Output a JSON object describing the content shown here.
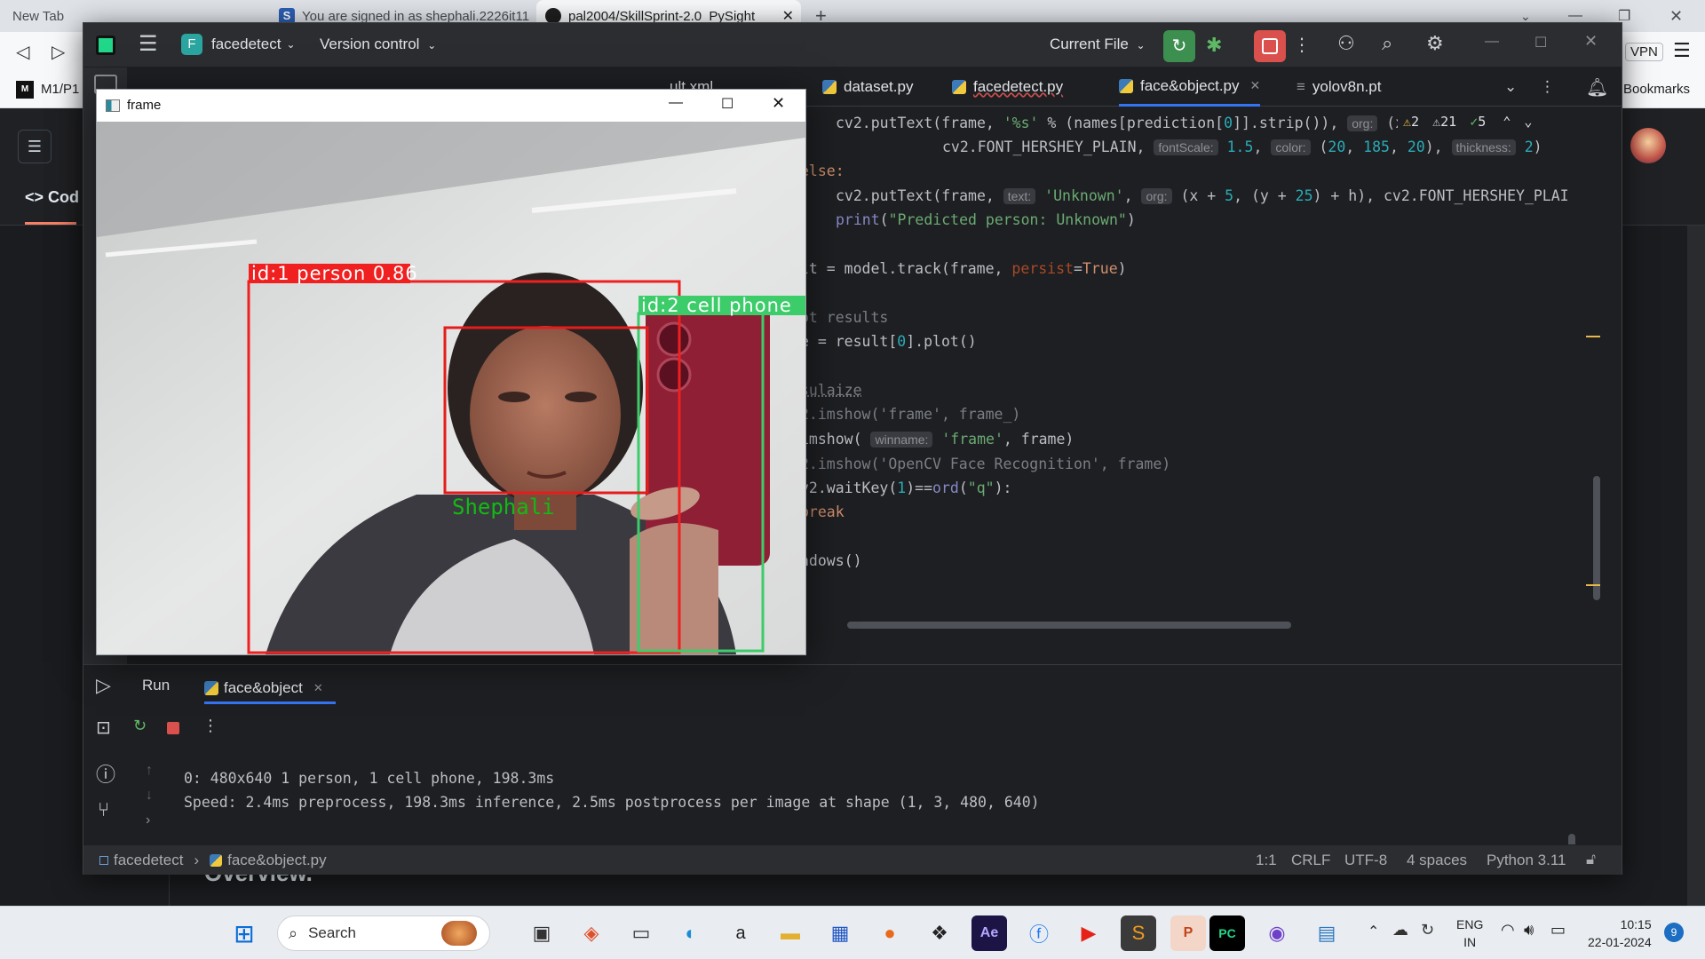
{
  "browser": {
    "tabs": [
      {
        "label": "New Tab",
        "active": false
      },
      {
        "label": "You are signed in as shephali.2226it11",
        "active": false
      },
      {
        "label": "pal2004/SkillSprint-2.0_PySight",
        "active": true
      }
    ],
    "bookmark_item": "M1/P1",
    "bookmarks_label": "Bookmarks",
    "vpn_label": "VPN",
    "page_nav_label": "Cod",
    "page_overview_text": "Overview."
  },
  "ide": {
    "project_icon_letter": "F",
    "project_name": "facedetect",
    "version_control": "Version control",
    "run_config": "Current File",
    "tabs": [
      {
        "label": "ult.xml",
        "active": false
      },
      {
        "label": "dataset.py",
        "active": false
      },
      {
        "label": "facedetect.py",
        "active": false
      },
      {
        "label": "face&object.py",
        "active": true
      },
      {
        "label": "yolov8n.pt",
        "active": false
      }
    ],
    "inspections": {
      "warnings": "2",
      "weak_warnings": "21",
      "ok": "5"
    },
    "code_lines": [
      {
        "plain": "cv2.putText(frame, '%s' % (names[prediction[0]].strip()), org: (x"
      },
      {
        "plain": "cv2.FONT_HERSHEY_PLAIN, fontScale: 1.5, color: (20, 185, 20), thickness: 2)"
      },
      {
        "plain": "else:"
      },
      {
        "plain": "cv2.putText(frame, text: 'Unknown', org: (x + 5, (y + 25) + h), cv2.FONT_HERSHEY_PLAI"
      },
      {
        "plain": "print(\"Predicted person: Unknown\")"
      },
      {
        "plain": "lt = model.track(frame, persist=True)"
      },
      {
        "plain": "ot results"
      },
      {
        "plain": "e = result[0].plot()"
      },
      {
        "plain": "sulaize"
      },
      {
        "plain": "2.imshow('frame', frame_)"
      },
      {
        "plain": "imshow( winname: 'frame', frame)"
      },
      {
        "plain": "2.imshow('OpenCV Face Recognition', frame)"
      },
      {
        "plain": "v2.waitKey(1)==ord(\"q\"):"
      },
      {
        "plain": "break"
      },
      {
        "plain": "ndows()"
      }
    ],
    "run_panel": {
      "run_label": "Run",
      "run_tab": "face&object",
      "output": [
        "0: 480x640 1 person, 1 cell phone, 198.3ms",
        "Speed: 2.4ms preprocess, 198.3ms inference, 2.5ms postprocess per image at shape (1, 3, 480, 640)"
      ]
    },
    "status": {
      "breadcrumb_project": "facedetect",
      "breadcrumb_file": "face&object.py",
      "position": "1:1",
      "line_sep": "CRLF",
      "encoding": "UTF-8",
      "indent": "4 spaces",
      "interpreter": "Python 3.11"
    }
  },
  "frame_window": {
    "title": "frame",
    "detections": [
      {
        "label": "id:1 person 0.86",
        "color": "#f02020"
      },
      {
        "label": "id:2 cell phone",
        "color": "#3ccc6a"
      }
    ],
    "face_label": "Shephali",
    "face_label_color": "#14b914"
  },
  "taskbar": {
    "search_placeholder": "Search",
    "language": "ENG",
    "region": "IN",
    "time": "10:15",
    "date": "22-01-2024",
    "notification_count": "9"
  }
}
